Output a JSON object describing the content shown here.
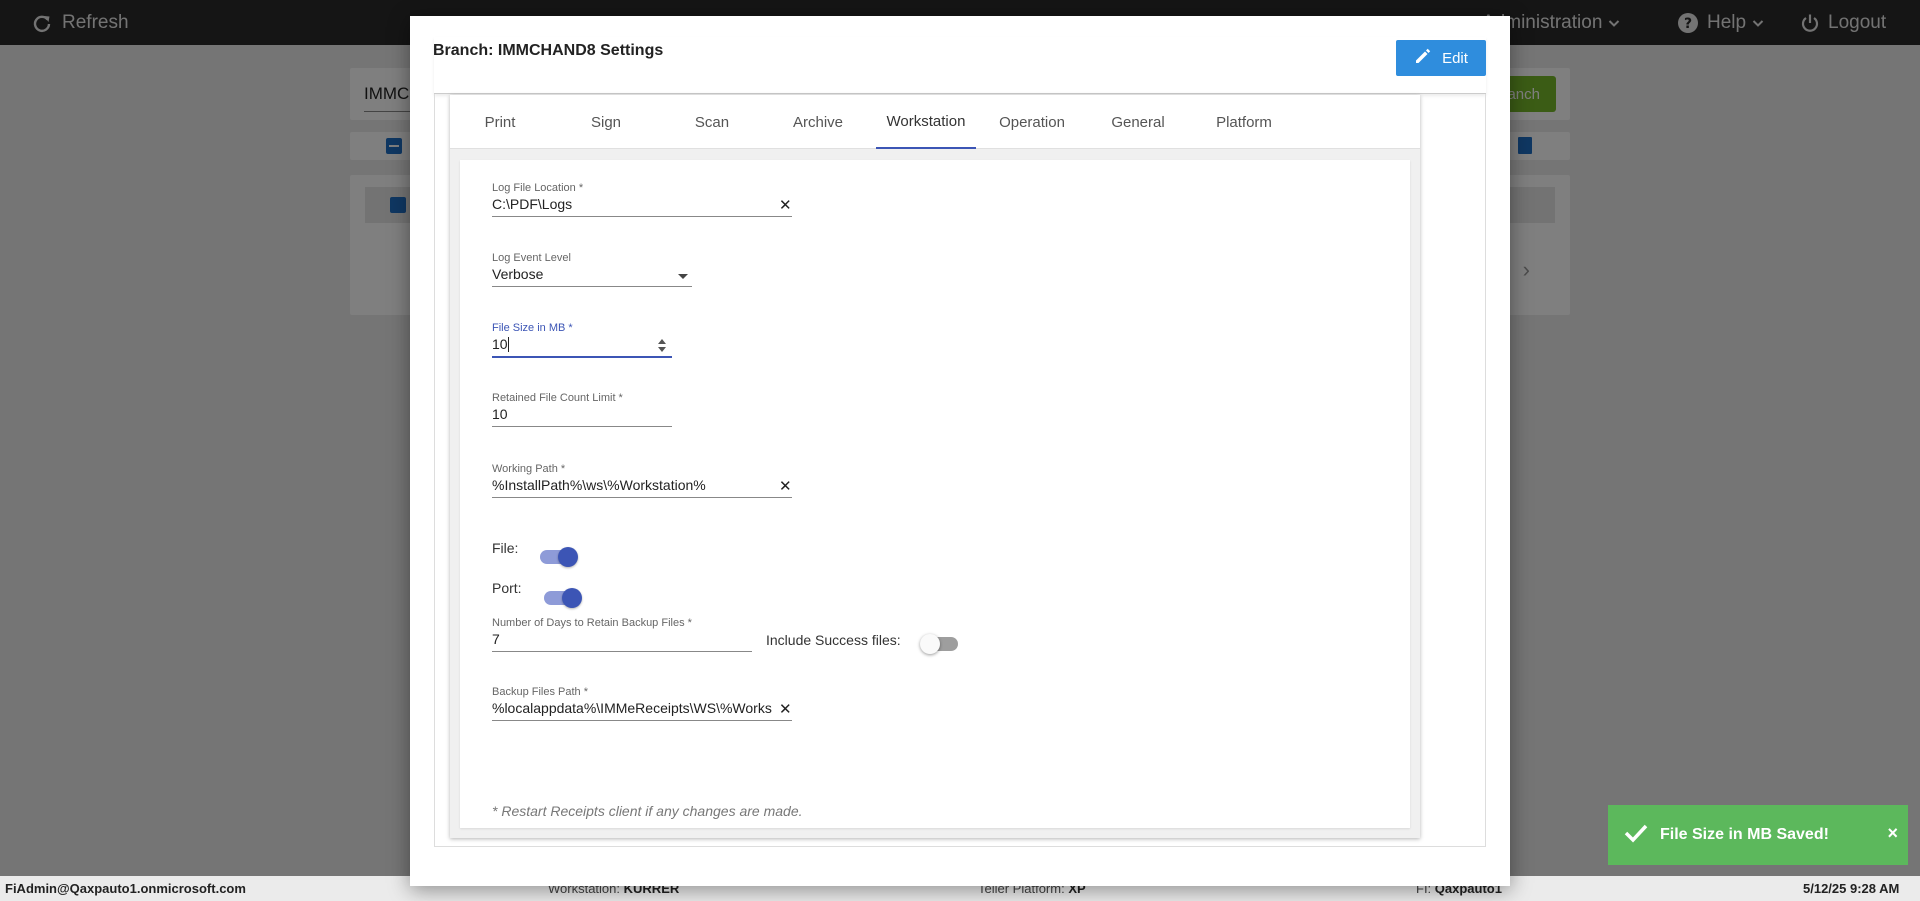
{
  "topbar": {
    "refresh_label": "Refresh",
    "administration_label": "Administration",
    "help_label": "Help",
    "logout_label": "Logout"
  },
  "background": {
    "search_text": "IMMC",
    "branch_button_label": "anch"
  },
  "status_bar": {
    "user": "FiAdmin@Qaxpauto1.onmicrosoft.com",
    "workstation_label": "Workstation:",
    "workstation_value": "KURRER",
    "teller_platform_label": "Teller Platform:",
    "teller_platform_value": "XP",
    "fi_label": "FI:",
    "fi_value": "Qaxpauto1",
    "datetime": "5/12/25 9:28 AM"
  },
  "modal": {
    "title": "Branch: IMMCHAND8 Settings",
    "edit_label": "Edit",
    "tabs": [
      {
        "label": "Print",
        "active": false
      },
      {
        "label": "Sign",
        "active": false
      },
      {
        "label": "Scan",
        "active": false
      },
      {
        "label": "Archive",
        "active": false
      },
      {
        "label": "Workstation",
        "active": true
      },
      {
        "label": "Operation",
        "active": false
      },
      {
        "label": "General",
        "active": false
      },
      {
        "label": "Platform",
        "active": false
      }
    ],
    "fields": {
      "log_file_location": {
        "label": "Log File Location *",
        "value": "C:\\PDF\\Logs"
      },
      "log_event_level": {
        "label": "Log Event Level",
        "value": "Verbose"
      },
      "file_size_mb": {
        "label": "File Size in MB *",
        "value": "10"
      },
      "retained_file_count": {
        "label": "Retained File Count Limit *",
        "value": "10"
      },
      "working_path": {
        "label": "Working Path *",
        "value": "%InstallPath%\\ws\\%Workstation%"
      },
      "file_toggle": {
        "label": "File:",
        "on": true
      },
      "port_toggle": {
        "label": "Port:",
        "on": true
      },
      "backup_days": {
        "label": "Number of Days to Retain Backup Files *",
        "value": "7"
      },
      "include_success": {
        "label": "Include Success files:",
        "on": false
      },
      "backup_path": {
        "label": "Backup Files Path *",
        "value": "%localappdata%\\IMMeReceipts\\WS\\%Works"
      }
    },
    "note": "* Restart Receipts client if any changes are made."
  },
  "toast": {
    "message": "File Size in MB Saved!",
    "close_glyph": "×"
  },
  "colors": {
    "accent": "#3c55b5",
    "edit_button": "#2f8ddd",
    "toast": "#5cb85c",
    "topbar": "#2a2a2a"
  }
}
